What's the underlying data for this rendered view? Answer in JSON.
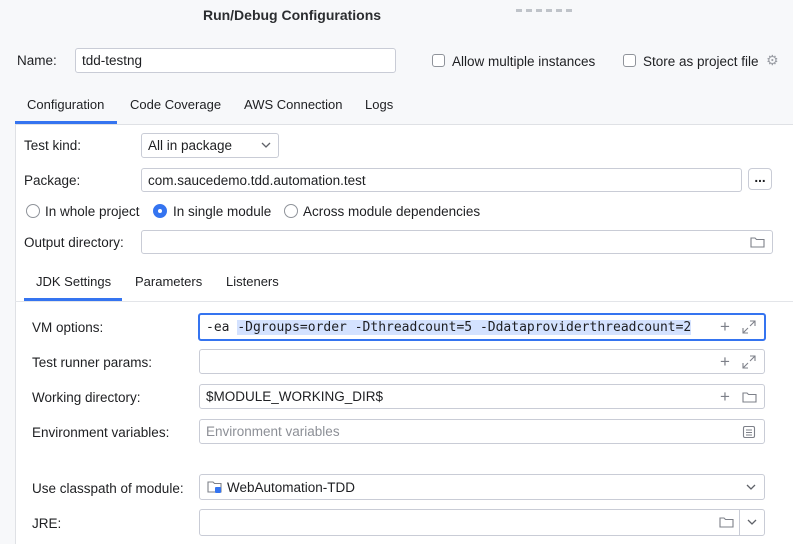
{
  "window": {
    "title": "Run/Debug Configurations"
  },
  "name_row": {
    "label": "Name:",
    "value": "tdd-testng",
    "allow_multiple_label": "Allow multiple instances",
    "store_label": "Store as project file"
  },
  "tabs": [
    "Configuration",
    "Code Coverage",
    "AWS Connection",
    "Logs"
  ],
  "config": {
    "test_kind_label": "Test kind:",
    "test_kind_value": "All in package",
    "package_label": "Package:",
    "package_value": "com.saucedemo.tdd.automation.test",
    "browse_label": "...",
    "radio_whole": "In whole project",
    "radio_single": "In single module",
    "radio_across": "Across module dependencies",
    "output_label": "Output directory:"
  },
  "subtabs": [
    "JDK Settings",
    "Parameters",
    "Listeners"
  ],
  "jdk": {
    "vm_label": "VM options:",
    "vm_prefix": "-ea ",
    "vm_selected": "-Dgroups=order -Dthreadcount=5 -Ddataproviderthreadcount=2",
    "runner_label": "Test runner params:",
    "workdir_label": "Working directory:",
    "workdir_value": "$MODULE_WORKING_DIR$",
    "env_label": "Environment variables:",
    "env_placeholder": "Environment variables",
    "classpath_label": "Use classpath of module:",
    "classpath_value": "WebAutomation-TDD",
    "jre_label": "JRE:"
  },
  "colors": {
    "accent": "#3574f0",
    "selection": "#d4e2ff"
  }
}
